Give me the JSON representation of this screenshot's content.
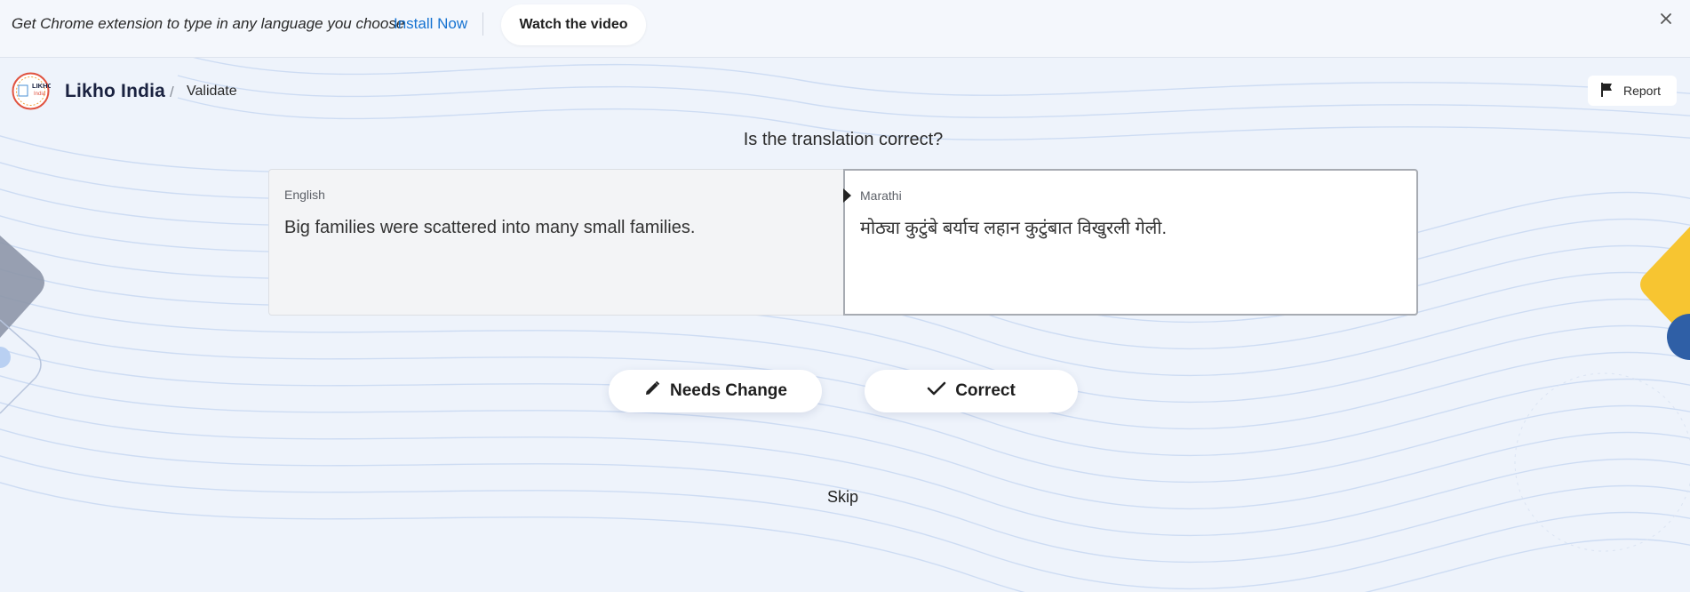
{
  "banner": {
    "text": "Get Chrome extension to type in any language you choose",
    "install_label": "Install Now",
    "watch_label": "Watch the video",
    "close_icon": "close-icon"
  },
  "header": {
    "logo_text_line1": "LIKHO",
    "logo_text_line2": "India",
    "brand": "Likho India",
    "separator": "/",
    "breadcrumb": "Validate",
    "report_label": "Report",
    "report_icon": "flag-icon"
  },
  "main": {
    "question": "Is the translation correct?",
    "source": {
      "language": "English",
      "text": "Big families were scattered into many small families."
    },
    "target": {
      "language": "Marathi",
      "text": "मोठ्या कुटुंबे बर्याच लहान कुटुंबात विखुरली गेली."
    },
    "needs_change_label": "Needs Change",
    "needs_change_icon": "pencil-icon",
    "correct_label": "Correct",
    "correct_icon": "check-icon",
    "skip_label": "Skip"
  },
  "colors": {
    "link": "#1673d1",
    "background": "#eef3fb",
    "accent_yellow": "#f7c531",
    "accent_blue": "#2f5fa6"
  }
}
